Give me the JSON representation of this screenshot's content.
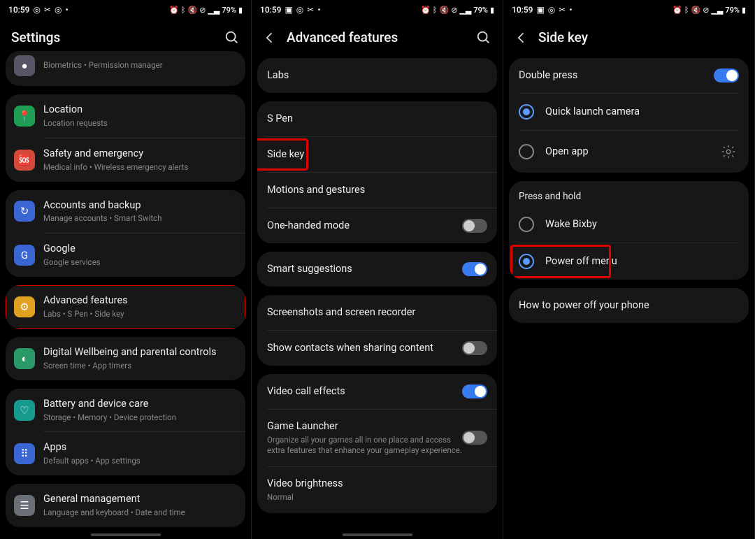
{
  "status": {
    "time": "10:59",
    "battery": "79%",
    "icons_left_a": [
      "instagram",
      "scissors",
      "instagram",
      "dot"
    ],
    "icons_left_b": [
      "image",
      "instagram",
      "scissors",
      "dot"
    ],
    "icons_right": [
      "alarm",
      "bluetooth",
      "mute",
      "wifi-off",
      "signal",
      "signal-2"
    ]
  },
  "panel1": {
    "title": "Settings",
    "groups": [
      {
        "cut": true,
        "items": [
          {
            "icon": "#556",
            "name": "biometrics",
            "title": "",
            "sub": "Biometrics  •  Permission manager"
          }
        ]
      },
      {
        "items": [
          {
            "icon": "#1e9e54",
            "glyph": "pin",
            "name": "location",
            "title": "Location",
            "sub": "Location requests"
          },
          {
            "icon": "#d44a3a",
            "glyph": "emerg",
            "name": "safety",
            "title": "Safety and emergency",
            "sub": "Medical info  •  Wireless emergency alerts"
          }
        ]
      },
      {
        "items": [
          {
            "icon": "#3a66d4",
            "glyph": "sync",
            "name": "accounts",
            "title": "Accounts and backup",
            "sub": "Manage accounts  •  Smart Switch"
          },
          {
            "icon": "#3a66d4",
            "glyph": "G",
            "name": "google",
            "title": "Google",
            "sub": "Google services"
          }
        ]
      },
      {
        "highlight": true,
        "items": [
          {
            "icon": "#e0a020",
            "glyph": "gear",
            "name": "advanced",
            "title": "Advanced features",
            "sub": "Labs  •  S Pen  •  Side key"
          }
        ]
      },
      {
        "items": [
          {
            "icon": "#2a9968",
            "glyph": "wellbeing",
            "name": "wellbeing",
            "title": "Digital Wellbeing and parental controls",
            "sub": "Screen time  •  App timers"
          }
        ]
      },
      {
        "items": [
          {
            "icon": "#159a8e",
            "glyph": "care",
            "name": "battery",
            "title": "Battery and device care",
            "sub": "Storage  •  Memory  •  Device protection"
          },
          {
            "icon": "#3a66d4",
            "glyph": "apps",
            "name": "apps",
            "title": "Apps",
            "sub": "Default apps  •  App settings"
          }
        ]
      },
      {
        "items": [
          {
            "icon": "#6a6f78",
            "glyph": "sliders",
            "name": "general",
            "title": "General management",
            "sub": "Language and keyboard  •  Date and time"
          }
        ]
      }
    ]
  },
  "panel2": {
    "title": "Advanced features",
    "groups": [
      {
        "items": [
          {
            "name": "labs",
            "title": "Labs"
          }
        ]
      },
      {
        "items": [
          {
            "name": "spen",
            "title": "S Pen"
          },
          {
            "name": "sidekey",
            "title": "Side key",
            "highlight": true
          },
          {
            "name": "motions",
            "title": "Motions and gestures"
          },
          {
            "name": "onehand",
            "title": "One-handed mode",
            "toggle": false
          }
        ]
      },
      {
        "items": [
          {
            "name": "smart",
            "title": "Smart suggestions",
            "toggle": true
          }
        ]
      },
      {
        "items": [
          {
            "name": "screenshots",
            "title": "Screenshots and screen recorder"
          },
          {
            "name": "contacts",
            "title": "Show contacts when sharing content",
            "toggle": false
          }
        ]
      },
      {
        "items": [
          {
            "name": "videocall",
            "title": "Video call effects",
            "toggle": true
          },
          {
            "name": "gamelauncher",
            "title": "Game Launcher",
            "sub": "Organize all your games all in one place and access extra features that enhance your gameplay experience.",
            "toggle": false
          },
          {
            "name": "videobright",
            "title": "Video brightness",
            "sub": "Normal"
          }
        ]
      }
    ]
  },
  "panel3": {
    "title": "Side key",
    "section1": {
      "header": {
        "title": "Double press",
        "toggle": true
      },
      "options": [
        {
          "name": "camera",
          "title": "Quick launch camera",
          "selected": true
        },
        {
          "name": "openapp",
          "title": "Open app",
          "selected": false,
          "gear": true
        }
      ]
    },
    "section2": {
      "label": "Press and hold",
      "options": [
        {
          "name": "bixby",
          "title": "Wake Bixby",
          "selected": false
        },
        {
          "name": "poweroff",
          "title": "Power off menu",
          "selected": true,
          "highlight": true
        }
      ]
    },
    "howto": "How to power off your phone"
  }
}
